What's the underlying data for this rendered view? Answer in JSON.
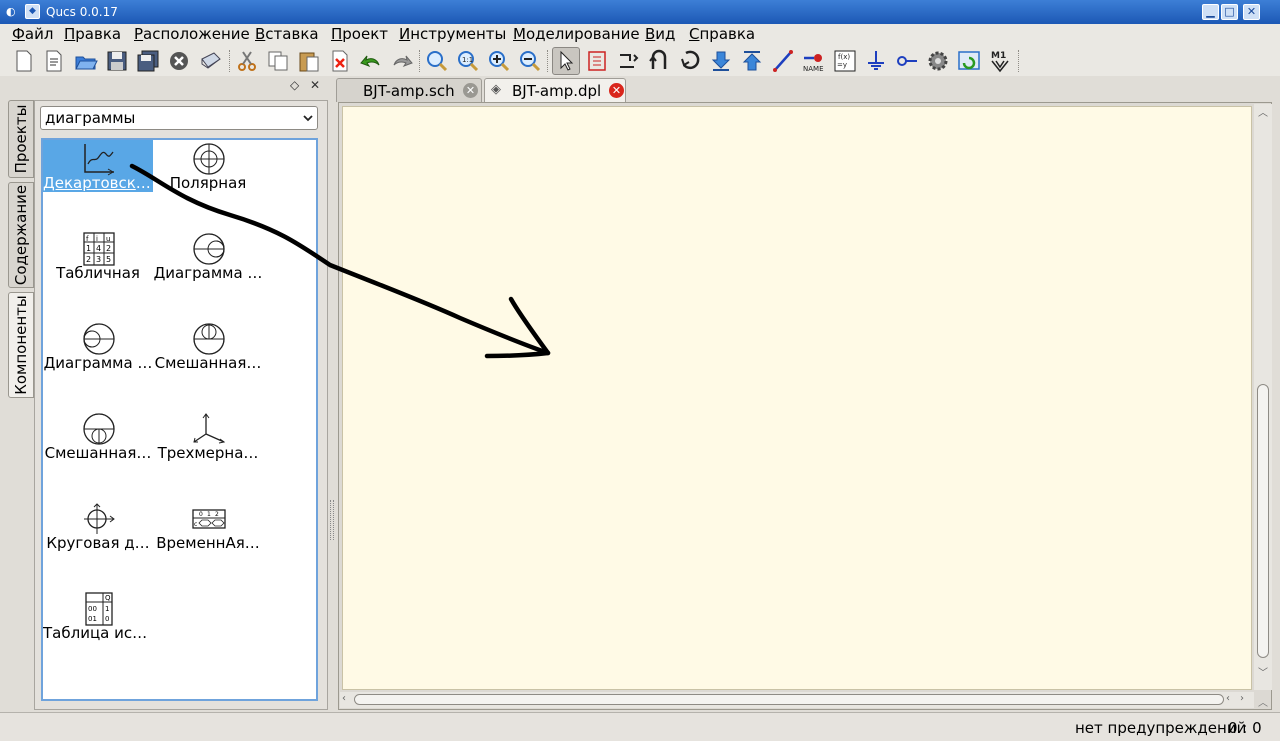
{
  "window": {
    "title": "Qucs 0.0.17"
  },
  "menu": [
    "Файл",
    "Правка",
    "Расположение",
    "Вставка",
    "Проект",
    "Инструменты",
    "Моделирование",
    "Вид",
    "Справка"
  ],
  "toolbar_icons": [
    "new-file-icon",
    "new-text-icon",
    "open-icon",
    "save-icon",
    "save-all-icon",
    "close-icon",
    "print-icon",
    "cut-icon",
    "copy-icon",
    "paste-icon",
    "delete-icon",
    "undo-icon",
    "redo-icon",
    "view-all-icon",
    "view-1-1-icon",
    "zoom-in-icon",
    "zoom-out-icon",
    "select-icon",
    "edit-properties-icon",
    "rotate-icon",
    "mirror-icon",
    "go-into-subcircuit-icon",
    "pop-out-icon",
    "move-down-icon",
    "wire-icon",
    "wire-label-icon",
    "equation-icon",
    "ground-icon",
    "port-icon",
    "simulate-icon",
    "view-data-display-icon",
    "marker-icon"
  ],
  "dock": {
    "tabs": [
      "Проекты",
      "Содержание",
      "Компоненты"
    ],
    "category": "диаграммы",
    "items": [
      {
        "label": "Декартовская",
        "icon": "cartesian-diagram-icon"
      },
      {
        "label": "Полярная",
        "icon": "polar-diagram-icon"
      },
      {
        "label": "Табличная",
        "icon": "tabular-icon"
      },
      {
        "label": "Диаграмма …",
        "icon": "smith-chart-icon"
      },
      {
        "label": "Диаграмма …",
        "icon": "admittance-smith-icon"
      },
      {
        "label": "Смешанная…",
        "icon": "polar-smith-icon"
      },
      {
        "label": "Смешанная…",
        "icon": "smith-polar-icon"
      },
      {
        "label": "Трехмерна…",
        "icon": "3d-cartesian-icon"
      },
      {
        "label": "Круговая д…",
        "icon": "locus-curve-icon"
      },
      {
        "label": "ВременнАя…",
        "icon": "timing-diagram-icon"
      },
      {
        "label": "Таблица ист…",
        "icon": "truth-table-icon"
      }
    ]
  },
  "doc_tabs": [
    {
      "label": "BJT-amp.sch",
      "active": false
    },
    {
      "label": "BJT-amp.dpl",
      "active": true
    }
  ],
  "status": {
    "warnings": "нет предупреждений",
    "position": "0 : 0"
  },
  "colors": {
    "canvas": "#fffae6",
    "selection": "#59a7e6",
    "title_bar": "#1c58b5"
  }
}
